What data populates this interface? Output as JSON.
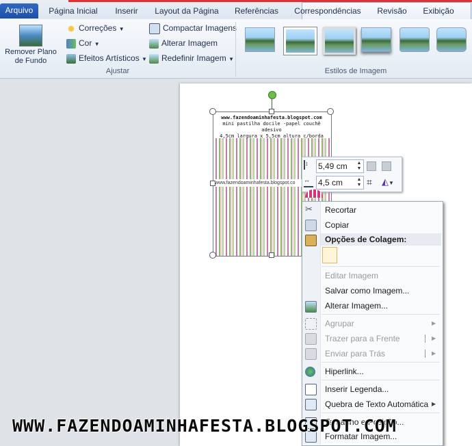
{
  "tabs": {
    "file": "Arquivo",
    "items": [
      "Página Inicial",
      "Inserir",
      "Layout da Página",
      "Referências",
      "Correspondências",
      "Revisão",
      "Exibição"
    ]
  },
  "ribbon": {
    "remove_bg": "Remover Plano de Fundo",
    "corrections": "Correções",
    "color": "Cor",
    "artistic": "Efeitos Artísticos",
    "compress": "Compactar Imagens",
    "change": "Alterar Imagem",
    "reset": "Redefinir Imagem",
    "group_adjust": "Ajustar",
    "group_styles": "Estilos de Imagem"
  },
  "image": {
    "line1": "www.fazendoaminhafesta.blogspot.com",
    "line2": "mini pastilha docile -papel couchê adesivo",
    "line3": "4,5cm largura x 5,5cm altura c/borda",
    "url": "www.fazendoaminhafesta.blogspot.co"
  },
  "mini_toolbar": {
    "height_value": "5,49 cm",
    "width_value": "4,5 cm"
  },
  "menu": {
    "cut": "Recortar",
    "copy": "Copiar",
    "paste_options": "Opções de Colagem:",
    "edit_image": "Editar Imagem",
    "save_as": "Salvar como Imagem...",
    "change_image": "Alterar Imagem...",
    "group": "Agrupar",
    "bring_front": "Trazer para a Frente",
    "send_back": "Enviar para Trás",
    "hyperlink": "Hiperlink...",
    "caption": "Inserir Legenda...",
    "wrap": "Quebra de Texto Automática",
    "size_pos": "Tamanho e Posição...",
    "format": "Formatar Imagem..."
  },
  "watermark": "WWW.FAZENDOAMINHAFESTA.BLOGSPOT.COM",
  "colors": {
    "accent": "#2b63bf",
    "stripe_pink": "#c47aa8",
    "stripe_green": "#8fb86a"
  }
}
